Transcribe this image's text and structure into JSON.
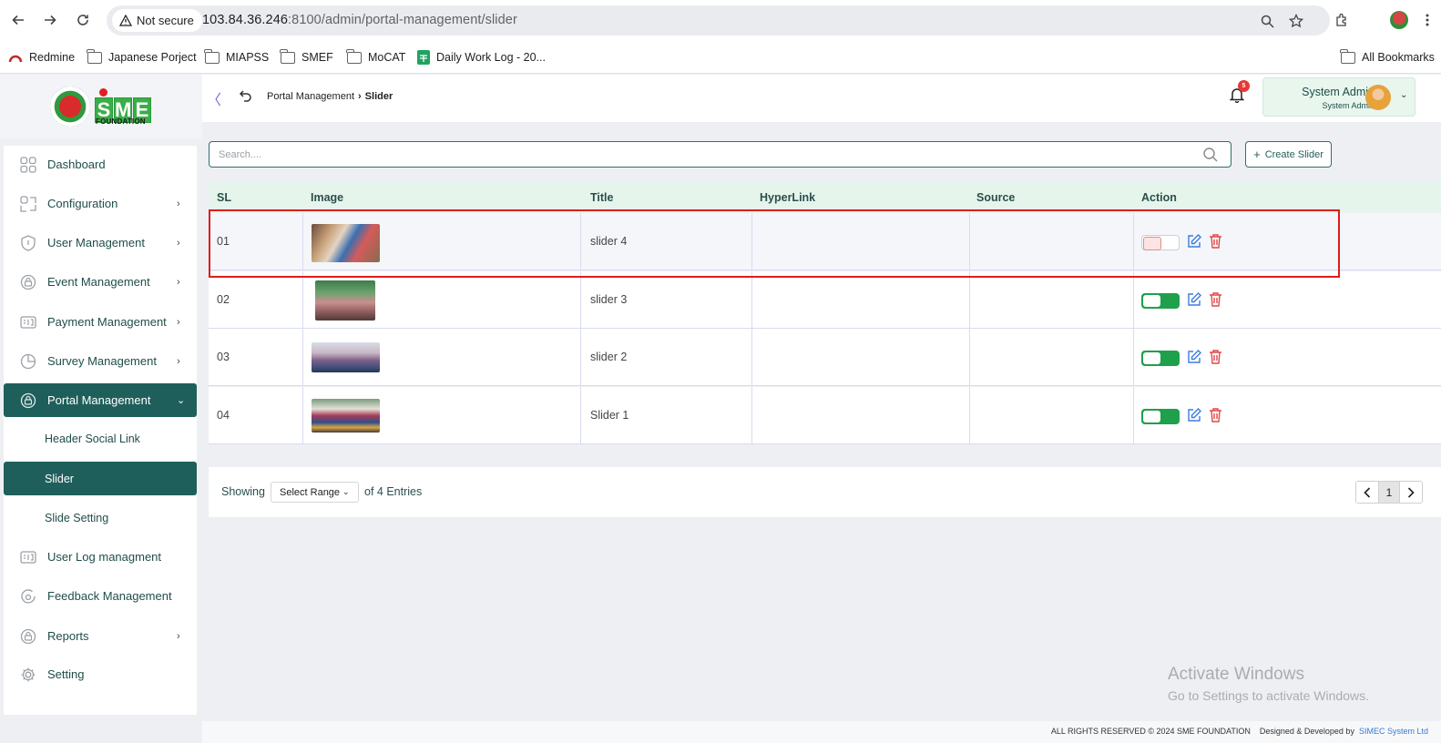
{
  "browser": {
    "security_label": "Not secure",
    "url_host": "103.84.36.246",
    "url_rest": ":8100/admin/portal-management/slider",
    "bookmarks": [
      {
        "label": "Redmine",
        "icon": "redmine-icon"
      },
      {
        "label": "Japanese Porject",
        "icon": "folder-icon"
      },
      {
        "label": "MIAPSS",
        "icon": "folder-icon"
      },
      {
        "label": "SMEF",
        "icon": "folder-icon"
      },
      {
        "label": "MoCAT",
        "icon": "folder-icon"
      },
      {
        "label": "Daily Work Log - 20...",
        "icon": "sheets-icon"
      }
    ],
    "all_bookmarks_label": "All Bookmarks"
  },
  "logo": {
    "text_s": "S",
    "text_m": "M",
    "text_e": "E",
    "foundation": "FOUNDATION"
  },
  "sidebar": {
    "items": [
      {
        "label": "Dashboard",
        "icon": "dashboard-icon",
        "has_children": false
      },
      {
        "label": "Configuration",
        "icon": "configuration-icon",
        "has_children": true
      },
      {
        "label": "User Management",
        "icon": "shield-icon",
        "has_children": true
      },
      {
        "label": "Event Management",
        "icon": "lock-icon",
        "has_children": true
      },
      {
        "label": "Payment Management",
        "icon": "id-card-icon",
        "has_children": true
      },
      {
        "label": "Survey Management",
        "icon": "pie-icon",
        "has_children": true
      },
      {
        "label": "Portal Management",
        "icon": "lock-icon",
        "has_children": true,
        "expanded": true
      },
      {
        "label": "User Log managment",
        "icon": "id-card-icon",
        "has_children": false
      },
      {
        "label": "Feedback Management",
        "icon": "feedback-icon",
        "has_children": false
      },
      {
        "label": "Reports",
        "icon": "lock-icon",
        "has_children": true
      },
      {
        "label": "Setting",
        "icon": "gear-icon",
        "has_children": false
      }
    ],
    "sub_items": [
      {
        "label": "Header Social Link"
      },
      {
        "label": "Slider",
        "active": true
      },
      {
        "label": "Slide Setting"
      }
    ]
  },
  "topbar": {
    "breadcrumb_parent": "Portal Management",
    "breadcrumb_current": "Slider",
    "notification_count": "5",
    "user_name": "System Admin",
    "user_role": "System Admin"
  },
  "search": {
    "placeholder": "Search...."
  },
  "create_button": "Create Slider",
  "table": {
    "headers": [
      "SL",
      "Image",
      "Title",
      "HyperLink",
      "Source",
      "Action"
    ],
    "rows": [
      {
        "sl": "01",
        "title": "slider 4",
        "hyperlink": "",
        "source": "",
        "active": false
      },
      {
        "sl": "02",
        "title": "slider 3",
        "hyperlink": "",
        "source": "",
        "active": true
      },
      {
        "sl": "03",
        "title": "slider 2",
        "hyperlink": "",
        "source": "",
        "active": true
      },
      {
        "sl": "04",
        "title": "Slider 1",
        "hyperlink": "",
        "source": "",
        "active": true
      }
    ]
  },
  "pagination": {
    "showing_label": "Showing",
    "range_label": "Select Range",
    "entries_label": "of 4 Entries",
    "current_page": "1"
  },
  "watermark": {
    "title": "Activate Windows",
    "subtitle": "Go to Settings to activate Windows."
  },
  "footer": {
    "copyright": "ALL RIGHTS RESERVED © 2024 SME FOUNDATION",
    "designed_by": "Designed & Developed by",
    "developer": "SIMEC System Ltd"
  },
  "colors": {
    "primary": "#1f5f5b",
    "toggle_on": "#1fa04b",
    "highlight": "#e01b1b",
    "header_row": "#e6f5ec"
  }
}
